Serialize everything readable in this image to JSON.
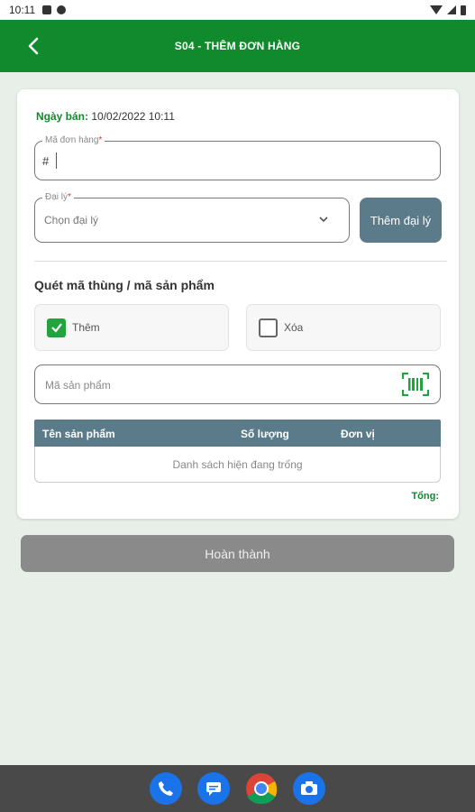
{
  "status_bar": {
    "time": "10:11"
  },
  "app_bar": {
    "title": "S04 - THÊM ĐƠN HÀNG"
  },
  "form": {
    "sale_date_label": "Ngày bán:",
    "sale_date_value": "10/02/2022 10:11",
    "order_code": {
      "label": "Mã đơn hàng",
      "required_mark": "*",
      "prefix": "#",
      "value": ""
    },
    "agent": {
      "label": "Đại lý",
      "required_mark": "*",
      "selected": "Chọn đại lý"
    },
    "add_agent_label": "Thêm đại lý"
  },
  "scan": {
    "title": "Quét mã thùng / mã sản phẩm",
    "mode_add": {
      "label": "Thêm",
      "checked": true
    },
    "mode_delete": {
      "label": "Xóa",
      "checked": false
    },
    "product_placeholder": "Mã sản phẩm"
  },
  "table": {
    "columns": [
      "Tên sản phẩm",
      "Số lượng",
      "Đơn vị"
    ],
    "empty_text": "Danh sách hiện đang trống"
  },
  "total_label": "Tổng:",
  "finish_label": "Hoàn thành",
  "dock": {
    "apps": [
      "phone-icon",
      "messages-icon",
      "chrome-icon",
      "camera-icon"
    ]
  },
  "colors": {
    "primary": "#118a2d",
    "header_slate": "#5b7b8a",
    "disabled": "#8a8a8a",
    "background": "#e8efe9"
  }
}
